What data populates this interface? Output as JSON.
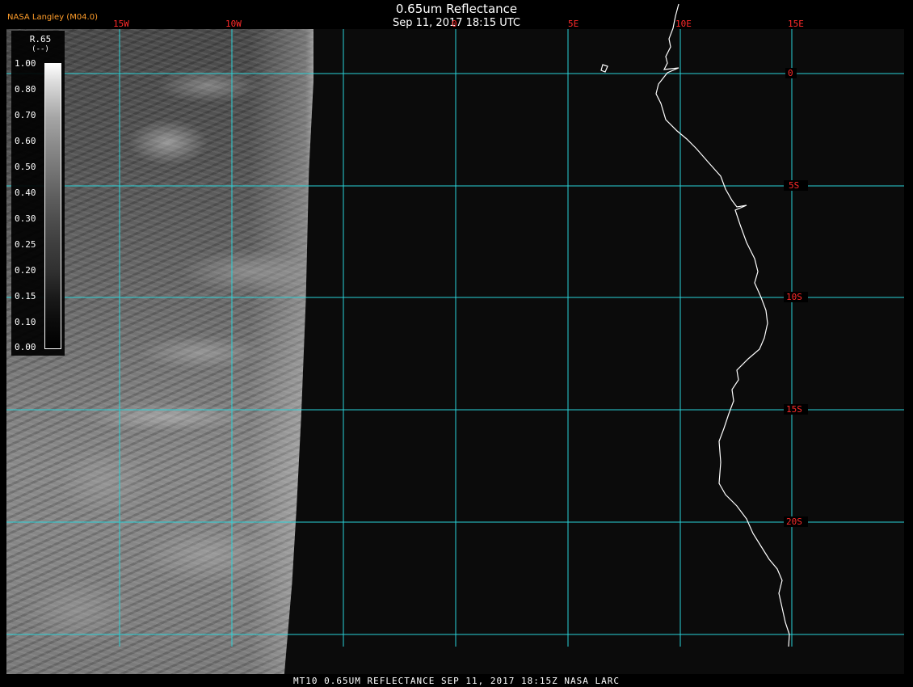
{
  "header": {
    "credit": "NASA Langley (M04.0)",
    "title": "0.65um Reflectance",
    "datetime": "Sep 11, 2017 18:15 UTC"
  },
  "legend": {
    "title_line1": "R.65",
    "title_line2": "(--)",
    "ticks": [
      "1.00",
      "0.80",
      "0.70",
      "0.60",
      "0.50",
      "0.40",
      "0.30",
      "0.25",
      "0.20",
      "0.15",
      "0.10",
      "0.00"
    ]
  },
  "map": {
    "longitude_labels": [
      "15W",
      "10W",
      "0",
      "5E",
      "10E",
      "15E"
    ],
    "latitude_labels": [
      "0",
      "5S",
      "10S",
      "15S",
      "20S"
    ],
    "colors": {
      "grid": "#2ad3d8",
      "grid_label": "#ff2a2a",
      "coast": "#ffffff",
      "credit": "#ff9d2a"
    }
  },
  "footer": {
    "caption": "MT10  0.65UM REFLECTANCE   SEP 11, 2017 18:15Z   NASA LARC"
  }
}
